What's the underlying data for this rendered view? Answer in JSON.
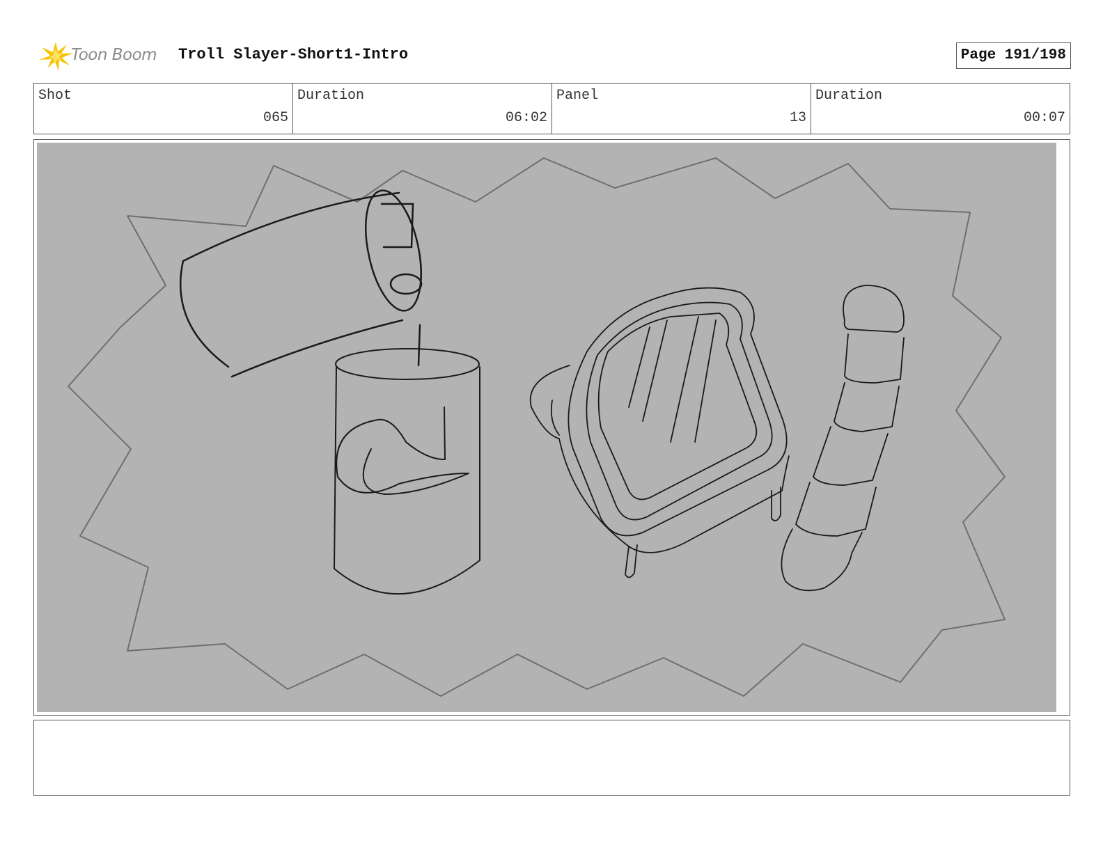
{
  "header": {
    "logo_text": "Toon Boom",
    "project_title": "Troll Slayer-Short1-Intro",
    "page_label": "Page 191/198"
  },
  "info": [
    {
      "label": "Shot",
      "value": "065"
    },
    {
      "label": "Duration",
      "value": "06:02"
    },
    {
      "label": "Panel",
      "value": "13"
    },
    {
      "label": "Duration",
      "value": "00:07"
    }
  ],
  "panel": {
    "background_color": "#b3b3b3",
    "content": "sketch"
  },
  "notes": {
    "text": ""
  },
  "colors": {
    "logo_accent": "#f5c400",
    "border": "#555555"
  }
}
